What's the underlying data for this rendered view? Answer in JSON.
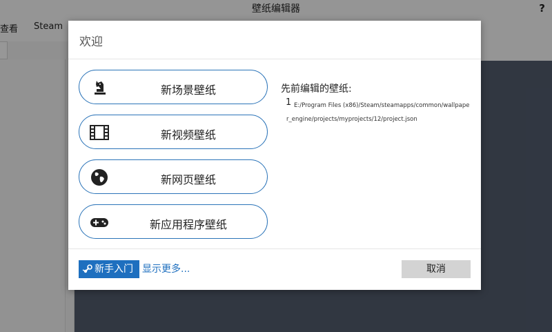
{
  "window": {
    "title": "壁纸编辑器",
    "help_label": "?"
  },
  "menubar": {
    "items": [
      "查看",
      "Steam"
    ]
  },
  "dialog": {
    "title": "欢迎",
    "options": [
      {
        "label": "新场景壁纸",
        "icon": "chess-knight-icon"
      },
      {
        "label": "新视频壁纸",
        "icon": "film-icon"
      },
      {
        "label": "新网页壁纸",
        "icon": "globe-icon"
      },
      {
        "label": "新应用程序壁纸",
        "icon": "gamepad-icon"
      }
    ],
    "recent": {
      "title": "先前编辑的壁纸:",
      "items": [
        {
          "index": "1",
          "path": "E:/Program Files (x86)/Steam/steamapps/common/wallpaper_engine/projects/myprojects/12/project.json"
        }
      ]
    },
    "footer": {
      "getting_started": "新手入门",
      "show_more": "显示更多...",
      "cancel": "取消"
    }
  },
  "colors": {
    "accent": "#1e6fbf",
    "option_border": "#2a73b8",
    "canvas": "#4f596a"
  }
}
